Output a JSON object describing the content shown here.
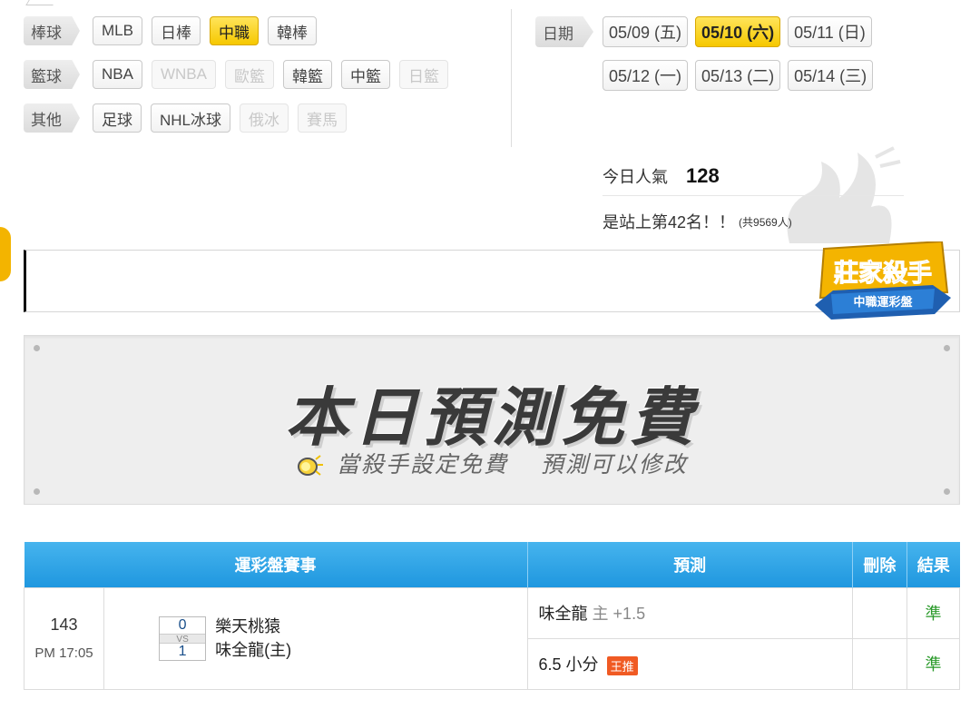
{
  "categories": [
    {
      "label": "棒球",
      "chips": [
        {
          "text": "MLB",
          "state": "normal"
        },
        {
          "text": "日棒",
          "state": "normal"
        },
        {
          "text": "中職",
          "state": "active"
        },
        {
          "text": "韓棒",
          "state": "normal"
        }
      ]
    },
    {
      "label": "籃球",
      "chips": [
        {
          "text": "NBA",
          "state": "normal"
        },
        {
          "text": "WNBA",
          "state": "disabled"
        },
        {
          "text": "歐籃",
          "state": "disabled"
        },
        {
          "text": "韓籃",
          "state": "normal"
        },
        {
          "text": "中籃",
          "state": "normal"
        },
        {
          "text": "日籃",
          "state": "disabled"
        }
      ]
    },
    {
      "label": "其他",
      "chips": [
        {
          "text": "足球",
          "state": "normal"
        },
        {
          "text": "NHL冰球",
          "state": "normal"
        },
        {
          "text": "俄冰",
          "state": "disabled"
        },
        {
          "text": "賽馬",
          "state": "disabled"
        }
      ]
    }
  ],
  "dates": {
    "label": "日期",
    "row1": [
      {
        "text": "05/09 (五)",
        "active": false
      },
      {
        "text": "05/10 (六)",
        "active": true
      },
      {
        "text": "05/11 (日)",
        "active": false
      }
    ],
    "row2": [
      {
        "text": "05/12 (一)",
        "active": false
      },
      {
        "text": "05/13 (二)",
        "active": false
      },
      {
        "text": "05/14 (三)",
        "active": false
      }
    ]
  },
  "popularity": {
    "label": "今日人氣",
    "count": "128",
    "rank_text": "是站上第42名！！",
    "total_text": "(共9569人)"
  },
  "badge": {
    "title": "莊家殺手",
    "ribbon": "中職運彩盤"
  },
  "banner": {
    "title": "本日預測免費",
    "subtitle_a": "當殺手設定免費",
    "subtitle_b": "預測可以修改"
  },
  "table": {
    "headers": {
      "match": "運彩盤賽事",
      "prediction": "預測",
      "delete": "刪除",
      "result": "結果"
    },
    "game": {
      "id": "143",
      "time": "PM 17:05",
      "away_score": "0",
      "vs": "VS",
      "home_score": "1",
      "away_team": "樂天桃猿",
      "home_team": "味全龍(主)"
    },
    "predictions": [
      {
        "team": "味全龍",
        "side": "主",
        "line": "+1.5",
        "tag": "",
        "result": "準"
      },
      {
        "team": "6.5 小分",
        "side": "",
        "line": "",
        "tag": "王推",
        "result": "準"
      }
    ]
  },
  "colors": {
    "accent_yellow": "#f6c800",
    "header_blue": "#1f97df",
    "tag_orange": "#f05a23",
    "result_green": "#2a9a2a"
  }
}
